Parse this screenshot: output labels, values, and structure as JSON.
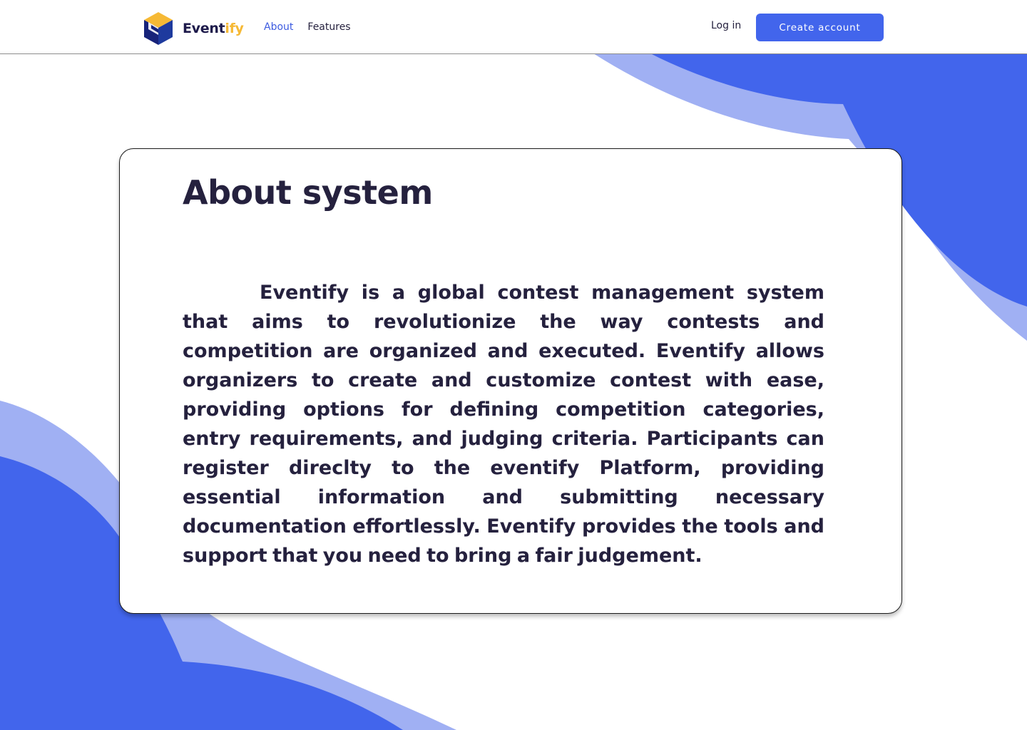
{
  "header": {
    "brand": {
      "name_main": "Event",
      "name_accent": "ify",
      "logo_icon": "cube-logo-icon"
    },
    "nav": {
      "about_label": "About",
      "features_label": "Features"
    },
    "login_label": "Log in",
    "create_account_label": "Create account"
  },
  "main": {
    "title": "About system",
    "body": "Eventify is a global contest management system that aims to revolutionize the way contests and competition are organized and executed. Eventify allows organizers to create and customize contest with ease, providing options for defining competition categories, entry requirements, and judging criteria. Participants can register direclty to the eventify Platform, providing essential information and submitting necessary documentation effortlessly. Eventify provides the tools and support that you need to bring a fair judgement."
  },
  "colors": {
    "primary_blue": "#4265ec",
    "light_blue": "#a0b0f3",
    "brand_yellow": "#f6b935",
    "text_dark": "#25213e",
    "nav_active": "#3d5be0"
  }
}
